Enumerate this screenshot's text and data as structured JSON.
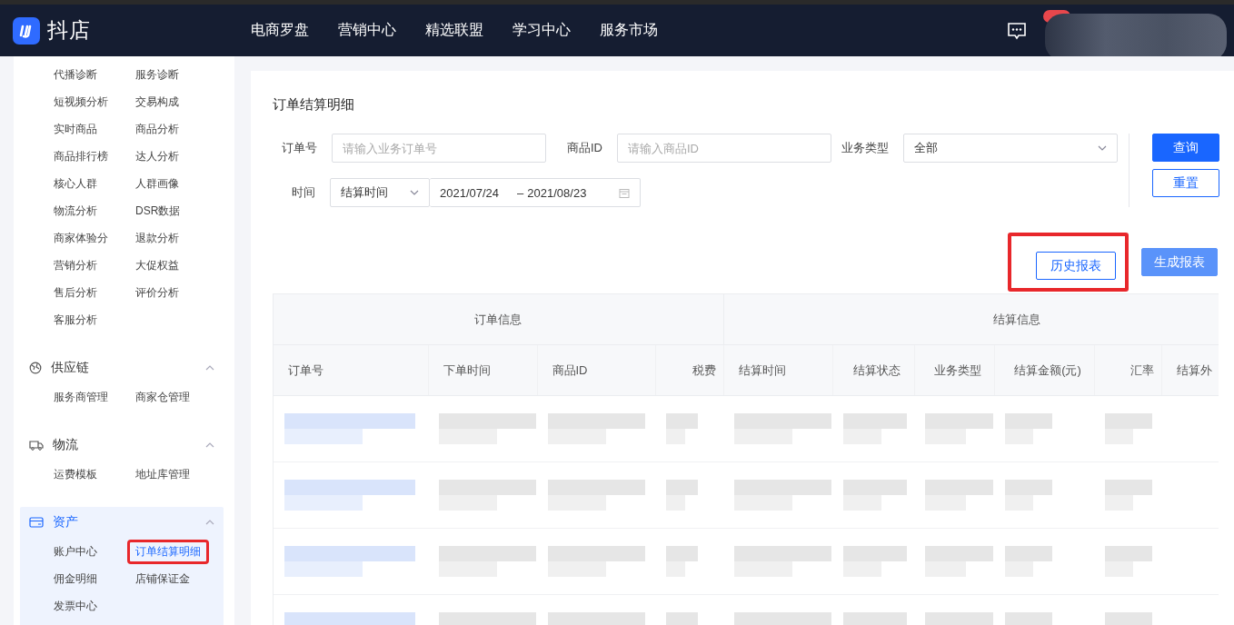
{
  "topbar": {
    "brand": "抖店",
    "nav": [
      "电商罗盘",
      "营销中心",
      "精选联盟",
      "学习中心",
      "服务市场"
    ],
    "notification_badge": true
  },
  "sidebar": {
    "groups": [
      {
        "items": [
          {
            "label": "代播诊断",
            "selected": false,
            "annotated": false
          },
          {
            "label": "服务诊断",
            "selected": false,
            "annotated": false
          },
          {
            "label": "短视频分析",
            "selected": false,
            "annotated": false
          },
          {
            "label": "交易构成",
            "selected": false,
            "annotated": false
          },
          {
            "label": "实时商品",
            "selected": false,
            "annotated": false
          },
          {
            "label": "商品分析",
            "selected": false,
            "annotated": false
          },
          {
            "label": "商品排行榜",
            "selected": false,
            "annotated": false
          },
          {
            "label": "达人分析",
            "selected": false,
            "annotated": false
          },
          {
            "label": "核心人群",
            "selected": false,
            "annotated": false
          },
          {
            "label": "人群画像",
            "selected": false,
            "annotated": false
          },
          {
            "label": "物流分析",
            "selected": false,
            "annotated": false
          },
          {
            "label": "DSR数据",
            "selected": false,
            "annotated": false
          },
          {
            "label": "商家体验分",
            "selected": false,
            "annotated": false
          },
          {
            "label": "退款分析",
            "selected": false,
            "annotated": false
          },
          {
            "label": "营销分析",
            "selected": false,
            "annotated": false
          },
          {
            "label": "大促权益",
            "selected": false,
            "annotated": false
          },
          {
            "label": "售后分析",
            "selected": false,
            "annotated": false
          },
          {
            "label": "评价分析",
            "selected": false,
            "annotated": false
          },
          {
            "label": "客服分析",
            "selected": false,
            "annotated": false
          }
        ]
      },
      {
        "title": "供应链",
        "expanded": true,
        "active": false,
        "items": [
          {
            "label": "服务商管理",
            "selected": false,
            "annotated": false
          },
          {
            "label": "商家仓管理",
            "selected": false,
            "annotated": false
          }
        ]
      },
      {
        "title": "物流",
        "expanded": true,
        "active": false,
        "items": [
          {
            "label": "运费模板",
            "selected": false,
            "annotated": false
          },
          {
            "label": "地址库管理",
            "selected": false,
            "annotated": false
          }
        ]
      },
      {
        "title": "资产",
        "expanded": true,
        "active": true,
        "items": [
          {
            "label": "账户中心",
            "selected": false,
            "annotated": false
          },
          {
            "label": "订单结算明细",
            "selected": true,
            "annotated": true
          },
          {
            "label": "佣金明细",
            "selected": false,
            "annotated": false
          },
          {
            "label": "店铺保证金",
            "selected": false,
            "annotated": false
          },
          {
            "label": "发票中心",
            "selected": false,
            "annotated": false
          }
        ]
      }
    ]
  },
  "page": {
    "title": "订单结算明细",
    "filters": {
      "order_no": {
        "label": "订单号",
        "placeholder": "请输入业务订单号"
      },
      "product_id": {
        "label": "商品ID",
        "placeholder": "请输入商品ID"
      },
      "business_type": {
        "label": "业务类型",
        "value": "全部"
      },
      "time": {
        "label": "时间",
        "type": "结算时间",
        "start": "2021/07/24",
        "separator": "–",
        "end": "2021/08/23"
      }
    },
    "side_buttons": [
      {
        "label": "查询",
        "kind": "primary"
      },
      {
        "label": "重置",
        "kind": "outline"
      }
    ],
    "report_buttons": [
      {
        "label": "历史报表",
        "kind": "outline",
        "annotated": true
      },
      {
        "label": "生成报表",
        "kind": "primary-light",
        "annotated": false
      }
    ],
    "table": {
      "groups": [
        {
          "label": "订单信息"
        },
        {
          "label": "结算信息"
        }
      ],
      "columns": [
        {
          "label": "订单号"
        },
        {
          "label": "下单时间"
        },
        {
          "label": "商品ID"
        },
        {
          "label": "税费"
        },
        {
          "label": "结算时间"
        },
        {
          "label": "结算状态"
        },
        {
          "label": "业务类型"
        },
        {
          "label": "结算金额(元)"
        },
        {
          "label": "汇率"
        },
        {
          "label": "结算外"
        }
      ],
      "rows": [
        {
          "redacted": true
        },
        {
          "redacted": true
        },
        {
          "redacted": true
        },
        {
          "redacted": true
        }
      ]
    }
  }
}
